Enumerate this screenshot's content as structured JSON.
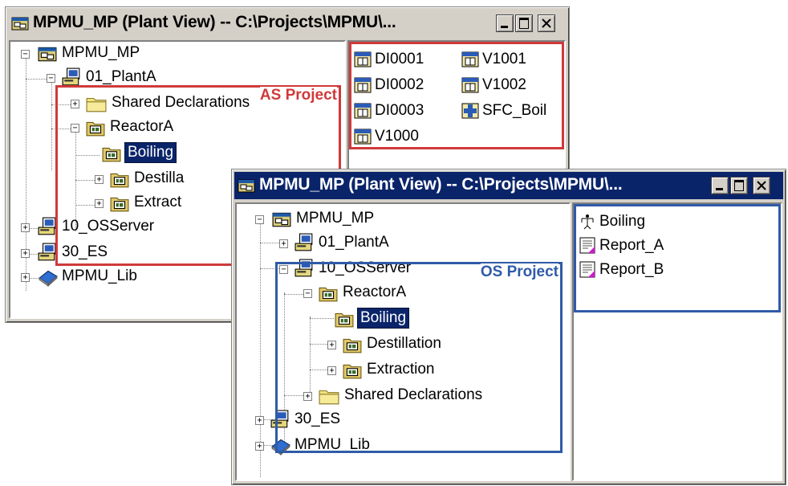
{
  "colors": {
    "as_highlight": "#d0393a",
    "os_highlight": "#2f5ba8",
    "title_active": "#0a246a"
  },
  "window_as": {
    "title": "MPMU_MP (Plant View) -- C:\\Projects\\MPMU\\...",
    "highlight_label": "AS Project",
    "tree": {
      "root": "MPMU_MP",
      "plant_a": "01_PlantA",
      "shared_declarations": "Shared Declarations",
      "reactor_a": "ReactorA",
      "boiling": "Boiling",
      "destillation": "Destilla",
      "extraction": "Extract",
      "os_server": "10_OSServer",
      "es": "30_ES",
      "lib": "MPMU_Lib"
    },
    "list": [
      "DI0001",
      "V1001",
      "DI0002",
      "V1002",
      "DI0003",
      "SFC_Boil",
      "V1000"
    ]
  },
  "window_os": {
    "title": "MPMU_MP (Plant View) -- C:\\Projects\\MPMU\\...",
    "highlight_label": "OS Project",
    "tree": {
      "root": "MPMU_MP",
      "plant_a": "01_PlantA",
      "os_server": "10_OSServer",
      "reactor_a": "ReactorA",
      "boiling": "Boiling",
      "destillation": "Destillation",
      "extraction": "Extraction",
      "shared_declarations": "Shared Declarations",
      "es": "30_ES",
      "lib": "MPMU_Lib"
    },
    "list": [
      "Boiling",
      "Report_A",
      "Report_B"
    ]
  },
  "icons": {
    "project": "multiproject-icon",
    "station": "station-icon",
    "folder": "folder-icon",
    "hierarchy": "hierarchy-folder-icon",
    "library": "library-icon",
    "block": "block-icon",
    "sfc": "sfc-chart-icon",
    "picture": "picture-icon",
    "report": "report-icon"
  }
}
